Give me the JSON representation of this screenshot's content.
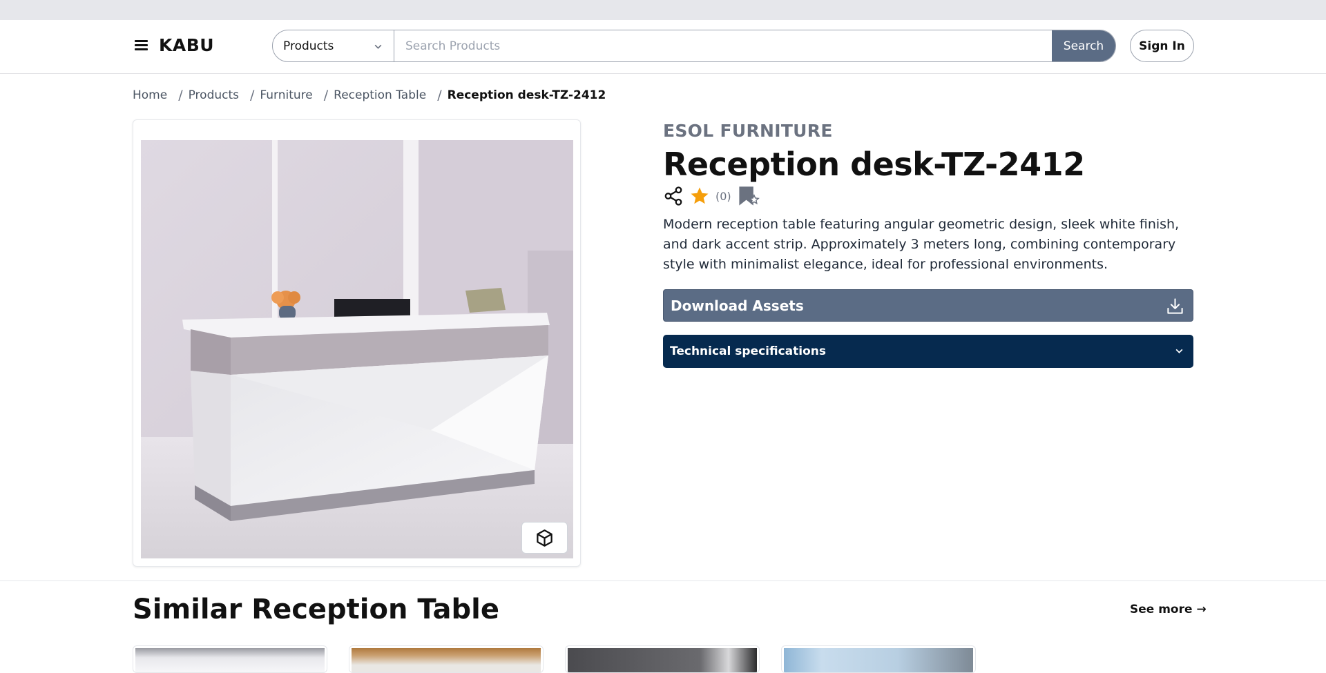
{
  "header": {
    "logo": "KABU",
    "category_selected": "Products",
    "search_placeholder": "Search Products",
    "search_value": "",
    "search_button": "Search",
    "sign_in": "Sign In"
  },
  "breadcrumb": [
    "Home",
    "Products",
    "Furniture",
    "Reception Table",
    "Reception desk-TZ-2412"
  ],
  "product": {
    "brand": "ESOL FURNITURE",
    "title": "Reception desk-TZ-2412",
    "rating_count": "(0)",
    "description": "Modern reception table featuring angular geometric design, sleek white finish, and dark accent strip. Approximately 3 meters long, combining contemporary style with minimalist elegance, ideal for professional environments.",
    "download_label": "Download Assets",
    "tech_label": "Technical specifications",
    "icons": [
      "share-icon",
      "star-icon",
      "bookmark-add-icon",
      "download-icon",
      "cube-3d-icon"
    ]
  },
  "similar": {
    "title": "Similar Reception Table",
    "see_more": "See more →"
  },
  "colors": {
    "accent_slate": "#5b6c85",
    "navy": "#062a4f",
    "star": "#f59e0b",
    "top_strip": "#e6e7eb"
  }
}
